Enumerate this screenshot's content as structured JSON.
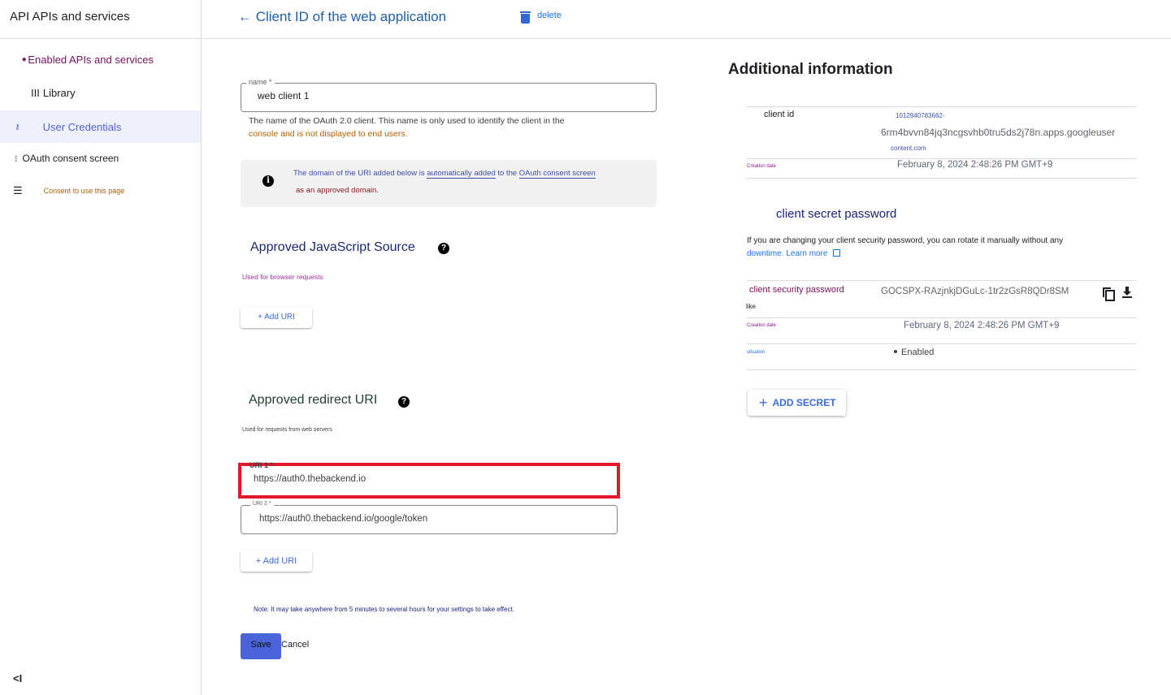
{
  "sidebar": {
    "header": "API APIs and services",
    "items": [
      {
        "icon": "diamond-icon",
        "glyph": "◆",
        "label": "Enabled APIs and services"
      },
      {
        "icon": "library-icon",
        "glyph": "III",
        "label": "Library"
      },
      {
        "icon": "key-icon",
        "glyph": "⚷",
        "label": "User Credentials"
      },
      {
        "icon": "oauth-icon",
        "glyph": "⁝",
        "label": "OAuth consent screen"
      },
      {
        "icon": "settings-list-icon",
        "glyph": "☰",
        "label": "Consent to use this page"
      }
    ],
    "collapse_glyph": "<I"
  },
  "topbar": {
    "back_title": "← Client ID of the web application",
    "delete_label": "delete"
  },
  "form": {
    "name_legend": "name *",
    "name_value": "web client 1",
    "name_help_1": "The name of the OAuth 2.0 client. This name is only used to identify the client in the",
    "name_help_2": "console and is not displayed to end users.",
    "info_pre": "The domain of the URI added below is ",
    "info_link1": "automatically added",
    "info_mid": " to the ",
    "info_link2": "OAuth consent screen",
    "info_line2": "as an approved domain.",
    "js_title": "Approved JavaScript Source",
    "js_sub": "Used for browser requests",
    "add_uri_1": "+ Add URI",
    "redirect_title": "Approved redirect URI",
    "redirect_sub": "Used for requests from web servers",
    "uri1_legend": "URI 1 *",
    "uri1_value": "https://auth0.thebackend.io",
    "uri2_legend": "URI 2 *",
    "uri2_value": "https://auth0.thebackend.io/google/token",
    "add_uri_2": "+ Add URI",
    "note": "Note: It may take anywhere from 5 minutes to several hours for your settings to take effect.",
    "save_label": "Save",
    "cancel_label": "Cancel"
  },
  "info": {
    "title": "Additional information",
    "client_id_label": "client id",
    "client_id_line1": "1012940783662-",
    "client_id_line2": "6rm4bvvn84jq3ncgsvhb0tru5ds2j78n.apps.googleuser",
    "client_id_line3": "content.com",
    "creation_label": "Creation date",
    "creation_value": "February 8, 2024 2:48:26 PM GMT+9",
    "secret_title": "client secret password",
    "rotate_text": "If you are changing your client security password, you can rotate it manually without any",
    "rotate_text2": "downtime. ",
    "learn_more": "Learn more",
    "secret_label": "client security password",
    "secret_value": "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",
    "like_label": "like",
    "secret_creation_label": "Creation date",
    "secret_creation_value": "February 8, 2024 2:48:26 PM GMT+9",
    "situation_label": "situation",
    "status_value": "Enabled",
    "add_secret_label": "ADD SECRET"
  },
  "colors": {
    "accent": "#4a63d8",
    "highlight_border": "#e0182b",
    "link": "#1a73e8"
  }
}
